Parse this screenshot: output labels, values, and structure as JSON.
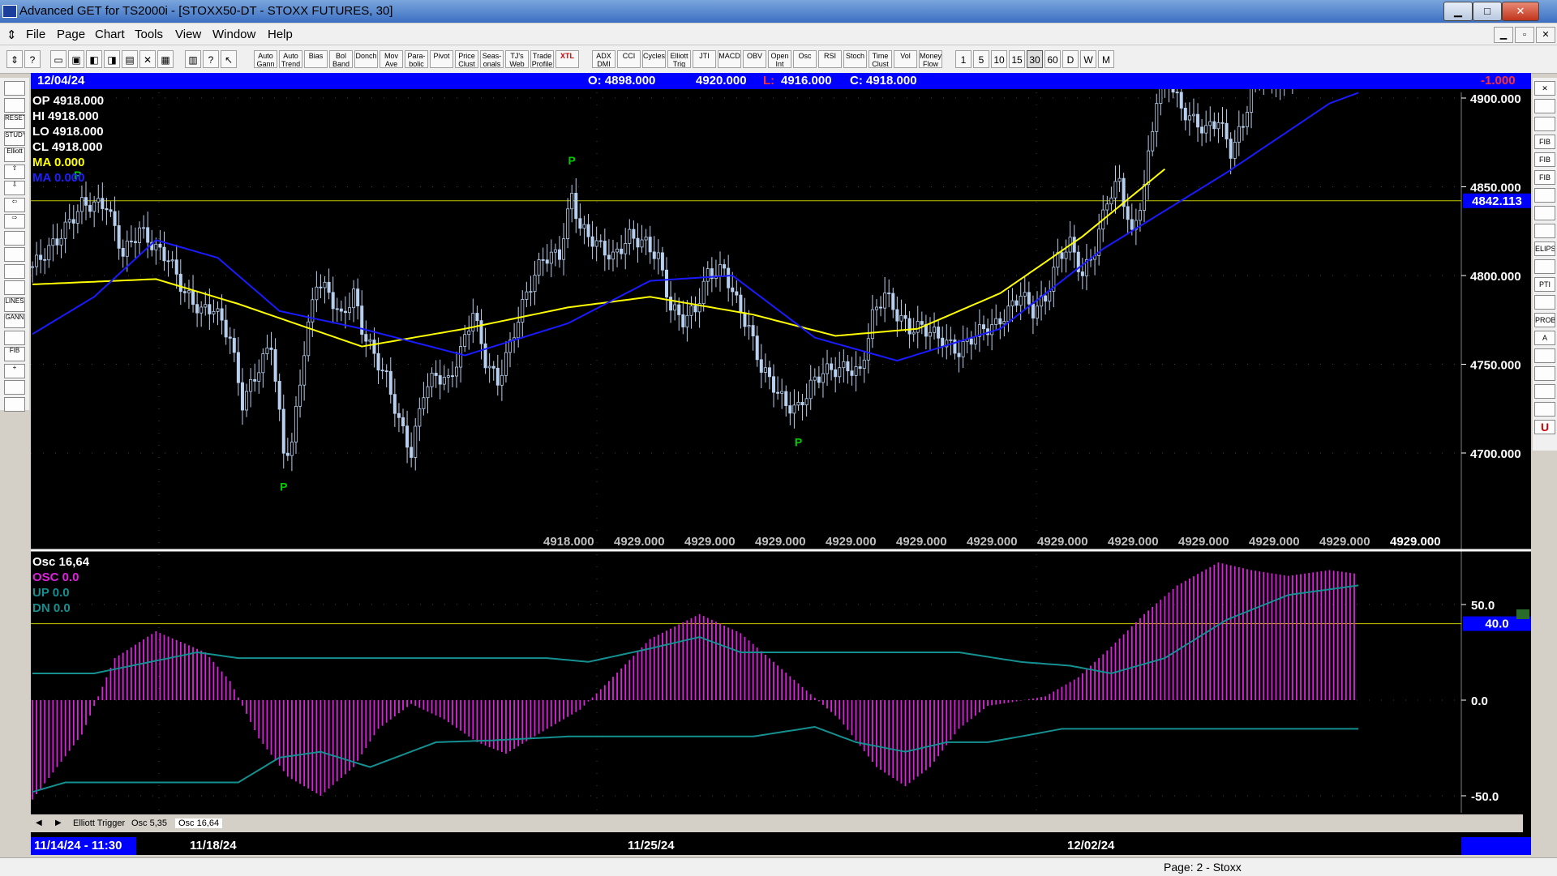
{
  "window": {
    "title": "Advanced GET for TS2000i - [STOXX50-DT - STOXX FUTURES, 30]",
    "min_glyph": "▁",
    "max_glyph": "□",
    "close_glyph": "✕"
  },
  "menu": {
    "items": [
      "File",
      "Page",
      "Chart",
      "Tools",
      "View",
      "Window",
      "Help"
    ],
    "mdi_min": "▁",
    "mdi_restore": "▫",
    "mdi_close": "✕"
  },
  "toolbar": {
    "study_buttons": [
      "Auto Gann",
      "Auto Trend",
      "Bias",
      "Bol Band",
      "Donch",
      "Mov Ave",
      "Para-bolic",
      "Pivot",
      "Price Clust",
      "Seas-onals",
      "TJ's Web",
      "Trade Profile",
      "XTL"
    ],
    "osc_buttons": [
      "ADX DMI",
      "CCI",
      "Cycles",
      "Elliott Trig",
      "JTI",
      "MACD",
      "OBV",
      "Open Int",
      "Osc",
      "RSI",
      "Stoch",
      "Time Clust",
      "Vol",
      "Money Flow"
    ],
    "interval_buttons": [
      "1",
      "5",
      "10",
      "15",
      "30",
      "60",
      "D",
      "W",
      "M"
    ],
    "selected_interval": "30"
  },
  "left_tools": [
    "",
    "",
    "RESET",
    "STUDY",
    "Elliott",
    "⇧",
    "⇩",
    "⇦",
    "⇨",
    "",
    "",
    "",
    "",
    "LINES",
    "GANN",
    "",
    "FIB",
    "+",
    "",
    ""
  ],
  "right_tools": [
    "✕",
    "",
    "",
    "FIB RET",
    "FIB EXT",
    "FIB TIME",
    "",
    "",
    "",
    "ELIPS",
    "",
    "PTI",
    "",
    "PROB",
    "A",
    "",
    "",
    "",
    "",
    "U"
  ],
  "header": {
    "date": "12/04/24",
    "open": "O: 4898.000",
    "high": "4920.000",
    "low_label": "L:",
    "low": "4916.000",
    "close": "C: 4918.000",
    "change": "-1.000"
  },
  "price_panel": {
    "legend": {
      "op": "OP  4918.000",
      "hi": "HI   4918.000",
      "lo": "LO  4918.000",
      "cl": "CL  4918.000",
      "ma1": "MA  0.000",
      "ma2": "MA  0.000"
    },
    "y_labels": [
      "4900.000",
      "4850.000",
      "4800.000",
      "4750.000",
      "4700.000"
    ],
    "current_value_box": "4842.113",
    "bottom_labels": [
      "4918.000",
      "4929.000",
      "4929.000",
      "4929.000",
      "4929.000",
      "4929.000",
      "4929.000",
      "4929.000",
      "4929.000",
      "4929.000",
      "4929.000",
      "4929.000",
      "4929.000"
    ],
    "pivot_label": "P",
    "colors": {
      "background": "#000000",
      "candles": "#b8d0f0",
      "ma_yellow": "#ffff00",
      "ma_blue": "#1a1aff",
      "pivot": "#00cc00",
      "hline": "#c8c800"
    }
  },
  "osc_panel": {
    "legend": {
      "title": "Osc 16,64",
      "osc": "OSC 0.0",
      "up": "UP   0.0",
      "dn": "DN   0.0"
    },
    "y_labels": [
      "50.0",
      "0.0",
      "-50.0"
    ],
    "current_value_box": "40.0",
    "colors": {
      "histogram": "#e020e0",
      "bands": "#159090"
    }
  },
  "tabs": [
    "Elliott Trigger",
    "Osc 5,35",
    "Osc 16,64"
  ],
  "tabs_arrows": {
    "left": "◀",
    "right": "▶"
  },
  "date_axis": {
    "first": "11/14/24 - 11:30",
    "labels": [
      "11/18/24",
      "11/25/24",
      "12/02/24"
    ]
  },
  "status": {
    "text": "Page: 2 - Stoxx"
  },
  "chart_data": {
    "type": "candlestick",
    "interval": "30 min",
    "y_range": [
      4700,
      4929
    ],
    "horizontal_line": 4842.113,
    "close_path": [
      [
        0,
        4805
      ],
      [
        6,
        4820
      ],
      [
        12,
        4840
      ],
      [
        18,
        4840
      ],
      [
        22,
        4812
      ],
      [
        26,
        4826
      ],
      [
        30,
        4815
      ],
      [
        33,
        4810
      ],
      [
        37,
        4790
      ],
      [
        41,
        4780
      ],
      [
        44,
        4782
      ],
      [
        48,
        4765
      ],
      [
        51,
        4728
      ],
      [
        55,
        4748
      ],
      [
        58,
        4762
      ],
      [
        61,
        4700
      ],
      [
        63,
        4705
      ],
      [
        66,
        4758
      ],
      [
        69,
        4797
      ],
      [
        72,
        4790
      ],
      [
        75,
        4776
      ],
      [
        78,
        4790
      ],
      [
        80,
        4770
      ],
      [
        83,
        4755
      ],
      [
        86,
        4742
      ],
      [
        89,
        4718
      ],
      [
        92,
        4700
      ],
      [
        95,
        4735
      ],
      [
        98,
        4744
      ],
      [
        101,
        4740
      ],
      [
        104,
        4757
      ],
      [
        107,
        4780
      ],
      [
        110,
        4752
      ],
      [
        113,
        4740
      ],
      [
        116,
        4761
      ],
      [
        120,
        4790
      ],
      [
        124,
        4810
      ],
      [
        128,
        4812
      ],
      [
        131,
        4845
      ],
      [
        133,
        4827
      ],
      [
        137,
        4818
      ],
      [
        141,
        4810
      ],
      [
        145,
        4822
      ],
      [
        149,
        4818
      ],
      [
        152,
        4810
      ],
      [
        155,
        4782
      ],
      [
        158,
        4775
      ],
      [
        161,
        4781
      ],
      [
        164,
        4801
      ],
      [
        168,
        4803
      ],
      [
        171,
        4785
      ],
      [
        174,
        4770
      ],
      [
        177,
        4748
      ],
      [
        180,
        4738
      ],
      [
        183,
        4727
      ],
      [
        186,
        4725
      ],
      [
        189,
        4738
      ],
      [
        192,
        4746
      ],
      [
        195,
        4747
      ],
      [
        198,
        4748
      ],
      [
        201,
        4745
      ],
      [
        204,
        4777
      ],
      [
        207,
        4790
      ],
      [
        210,
        4778
      ],
      [
        213,
        4770
      ],
      [
        216,
        4771
      ],
      [
        219,
        4767
      ],
      [
        222,
        4762
      ],
      [
        225,
        4757
      ],
      [
        228,
        4765
      ],
      [
        231,
        4770
      ],
      [
        234,
        4772
      ],
      [
        237,
        4780
      ],
      [
        240,
        4790
      ],
      [
        243,
        4780
      ],
      [
        246,
        4787
      ],
      [
        249,
        4810
      ],
      [
        252,
        4818
      ],
      [
        255,
        4800
      ],
      [
        258,
        4815
      ],
      [
        261,
        4843
      ],
      [
        264,
        4853
      ],
      [
        267,
        4822
      ],
      [
        270,
        4850
      ],
      [
        273,
        4900
      ],
      [
        276,
        4910
      ],
      [
        279,
        4894
      ],
      [
        282,
        4887
      ],
      [
        285,
        4882
      ],
      [
        288,
        4888
      ],
      [
        291,
        4870
      ],
      [
        294,
        4885
      ],
      [
        297,
        4917
      ],
      [
        300,
        4910
      ],
      [
        303,
        4910
      ],
      [
        306,
        4915
      ],
      [
        309,
        4920
      ],
      [
        312,
        4920
      ],
      [
        315,
        4920
      ],
      [
        318,
        4924
      ],
      [
        321,
        4918
      ]
    ],
    "ma_yellow": [
      [
        0,
        4795
      ],
      [
        30,
        4798
      ],
      [
        50,
        4784
      ],
      [
        80,
        4760
      ],
      [
        105,
        4770
      ],
      [
        130,
        4782
      ],
      [
        150,
        4788
      ],
      [
        175,
        4778
      ],
      [
        195,
        4766
      ],
      [
        215,
        4770
      ],
      [
        235,
        4790
      ],
      [
        255,
        4822
      ],
      [
        275,
        4860
      ]
    ],
    "ma_blue": [
      [
        0,
        4767
      ],
      [
        15,
        4788
      ],
      [
        30,
        4820
      ],
      [
        45,
        4810
      ],
      [
        60,
        4780
      ],
      [
        80,
        4770
      ],
      [
        105,
        4755
      ],
      [
        130,
        4773
      ],
      [
        150,
        4797
      ],
      [
        170,
        4800
      ],
      [
        190,
        4765
      ],
      [
        210,
        4752
      ],
      [
        235,
        4770
      ],
      [
        260,
        4815
      ],
      [
        290,
        4858
      ],
      [
        315,
        4897
      ],
      [
        322,
        4903
      ]
    ],
    "pivots": [
      {
        "i": 11,
        "type": "high"
      },
      {
        "i": 61,
        "type": "low"
      },
      {
        "i": 131,
        "type": "high"
      },
      {
        "i": 186,
        "type": "low"
      }
    ],
    "osc_range": [
      -55,
      75
    ],
    "osc_level_line": 40,
    "oscillator": [
      [
        0,
        -52
      ],
      [
        12,
        -18
      ],
      [
        20,
        22
      ],
      [
        30,
        36
      ],
      [
        42,
        25
      ],
      [
        48,
        10
      ],
      [
        55,
        -20
      ],
      [
        62,
        -40
      ],
      [
        70,
        -50
      ],
      [
        78,
        -35
      ],
      [
        84,
        -15
      ],
      [
        92,
        -2
      ],
      [
        100,
        -10
      ],
      [
        108,
        -22
      ],
      [
        115,
        -28
      ],
      [
        125,
        -15
      ],
      [
        133,
        -5
      ],
      [
        140,
        10
      ],
      [
        150,
        32
      ],
      [
        162,
        45
      ],
      [
        172,
        35
      ],
      [
        180,
        20
      ],
      [
        188,
        5
      ],
      [
        196,
        -10
      ],
      [
        205,
        -35
      ],
      [
        212,
        -45
      ],
      [
        218,
        -35
      ],
      [
        225,
        -15
      ],
      [
        232,
        -3
      ],
      [
        238,
        -1
      ],
      [
        246,
        2
      ],
      [
        254,
        12
      ],
      [
        262,
        28
      ],
      [
        270,
        45
      ],
      [
        278,
        60
      ],
      [
        288,
        72
      ],
      [
        296,
        68
      ],
      [
        305,
        65
      ],
      [
        315,
        68
      ],
      [
        322,
        66
      ]
    ],
    "band_up": [
      [
        0,
        14
      ],
      [
        15,
        14
      ],
      [
        40,
        25
      ],
      [
        50,
        22
      ],
      [
        65,
        22
      ],
      [
        100,
        22
      ],
      [
        125,
        22
      ],
      [
        135,
        20
      ],
      [
        150,
        27
      ],
      [
        162,
        33
      ],
      [
        172,
        25
      ],
      [
        195,
        25
      ],
      [
        225,
        25
      ],
      [
        240,
        20
      ],
      [
        252,
        18
      ],
      [
        262,
        14
      ],
      [
        275,
        22
      ],
      [
        290,
        42
      ],
      [
        305,
        55
      ],
      [
        322,
        60
      ]
    ],
    "band_dn": [
      [
        0,
        -48
      ],
      [
        8,
        -43
      ],
      [
        30,
        -43
      ],
      [
        50,
        -43
      ],
      [
        60,
        -30
      ],
      [
        70,
        -27
      ],
      [
        82,
        -35
      ],
      [
        98,
        -22
      ],
      [
        112,
        -21
      ],
      [
        130,
        -19
      ],
      [
        145,
        -19
      ],
      [
        175,
        -19
      ],
      [
        190,
        -14
      ],
      [
        200,
        -22
      ],
      [
        212,
        -27
      ],
      [
        222,
        -22
      ],
      [
        232,
        -22
      ],
      [
        240,
        -19
      ],
      [
        250,
        -15
      ],
      [
        275,
        -15
      ],
      [
        300,
        -15
      ],
      [
        322,
        -15
      ]
    ]
  }
}
